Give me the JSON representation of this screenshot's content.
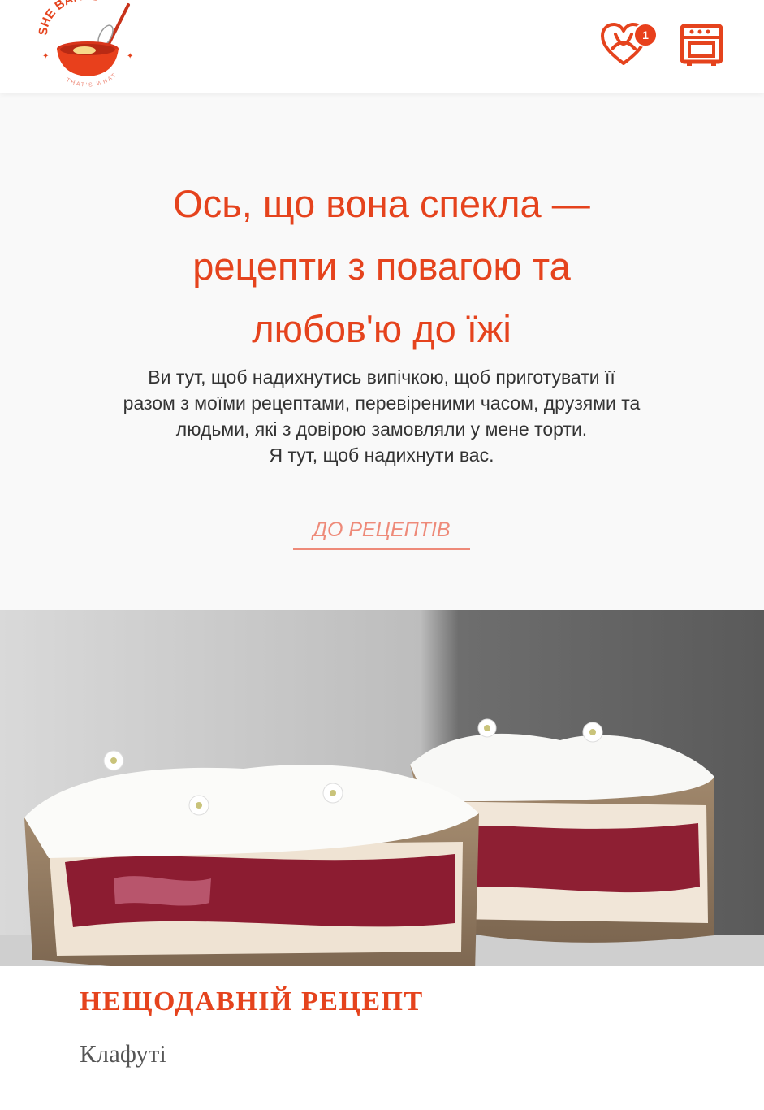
{
  "header": {
    "logo_text": "SHE BAKED",
    "logo_tagline": "THAT'S WHAT",
    "favorites_icon": "heart-pretzel-icon",
    "favorites_count": "1",
    "oven_icon": "oven-icon"
  },
  "hero": {
    "title_line1": "Ось, що вона спекла —",
    "title_line2": "рецепти з повагою та",
    "title_line3": "любов'ю до їжі",
    "text_line1": "Ви тут, щоб надихнутись випічкою, щоб приготувати її",
    "text_line2": "разом з моїми рецептами, перевіреними часом, друзями та",
    "text_line3": "людьми, які з довірою замовляли у мене торти.",
    "text_line4": "Я тут, щоб надихнути вас.",
    "cta_label": "ДО РЕЦЕПТІВ"
  },
  "recent": {
    "heading": "НЕЩОДАВНІЙ РЕЦЕПТ",
    "recipe_name": "Клафуті"
  },
  "colors": {
    "accent": "#e5431d",
    "link": "#ee8a79",
    "hero_bg": "#f9f9f9"
  }
}
